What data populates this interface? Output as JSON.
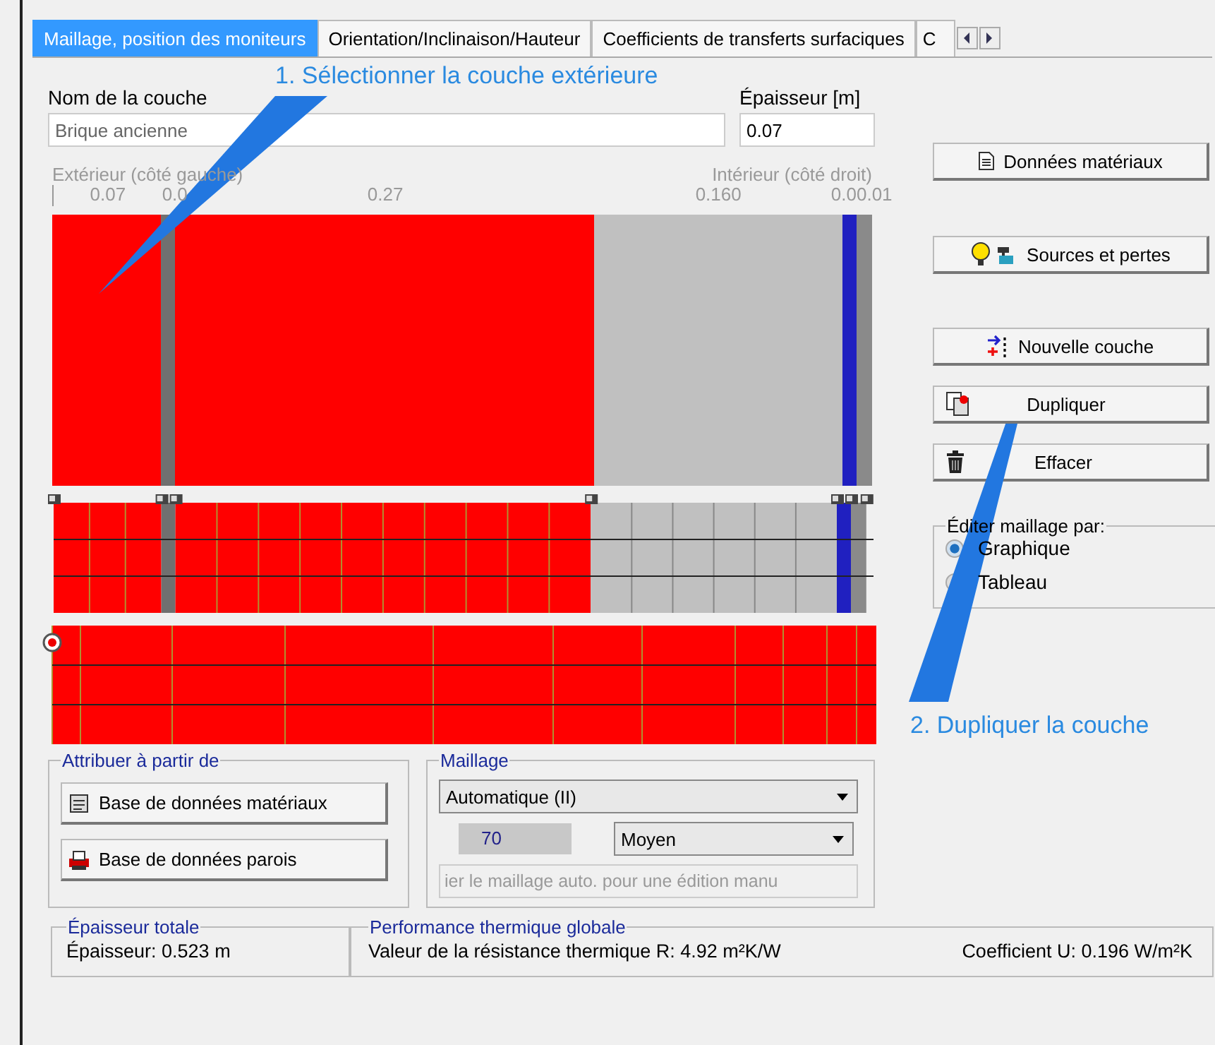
{
  "tabs": [
    {
      "label": "Maillage, position des moniteurs",
      "selected": true
    },
    {
      "label": "Orientation/Inclinaison/Hauteur",
      "selected": false
    },
    {
      "label": "Coefficients de transferts surfaciques",
      "selected": false
    },
    {
      "label": "C",
      "selected": false
    }
  ],
  "annotations": [
    "1. Sélectionner la couche extérieure",
    "2. Dupliquer la couche"
  ],
  "layer_name": {
    "label": "Nom de la couche",
    "value": "Brique ancienne"
  },
  "thickness": {
    "label": "Épaisseur [m]",
    "value": "0.07"
  },
  "wall": {
    "left_label": "Extérieur (côté gauche)",
    "right_label": "Intérieur (côté droit)",
    "layers": [
      {
        "label": "0.07",
        "color": "#ff0000"
      },
      {
        "label": "0.0",
        "color": "#707070"
      },
      {
        "label": "0.27",
        "color": "#ff0000"
      },
      {
        "label": "0.160",
        "color": "#c0c0c0"
      },
      {
        "label": "0.0",
        "color": "#2020c0"
      },
      {
        "label": "0.01",
        "color": "#8a8a8a"
      }
    ]
  },
  "side_buttons": [
    {
      "label": "Données matériaux",
      "kind": "doc"
    },
    {
      "label": "Sources et pertes",
      "kind": "sources"
    },
    {
      "label": "Nouvelle couche",
      "kind": "new"
    },
    {
      "label": "Dupliquer",
      "kind": "copy"
    },
    {
      "label": "Effacer",
      "kind": "trash"
    }
  ],
  "mesh_edit": {
    "title": "Éditer maillage par:",
    "options": [
      {
        "label": "Graphique",
        "selected": true
      },
      {
        "label": "Tableau",
        "selected": false
      }
    ]
  },
  "assign": {
    "title": "Attribuer à partir de",
    "buttons": [
      {
        "label": "Base de données matériaux",
        "kind": "db"
      },
      {
        "label": "Base de données parois",
        "kind": "wall"
      }
    ]
  },
  "mesh": {
    "title": "Maillage",
    "mode": "Automatique (II)",
    "count": "70",
    "density": "Moyen",
    "note": "ier le maillage auto. pour une édition manu"
  },
  "total": {
    "title": "Épaisseur totale",
    "value": "Épaisseur: 0.523 m"
  },
  "performance": {
    "title": "Performance thermique globale",
    "resistance": "Valeur de la résistance thermique R: 4.92 m²K/W",
    "u_value": "Coefficient U: 0.196 W/m²K"
  }
}
